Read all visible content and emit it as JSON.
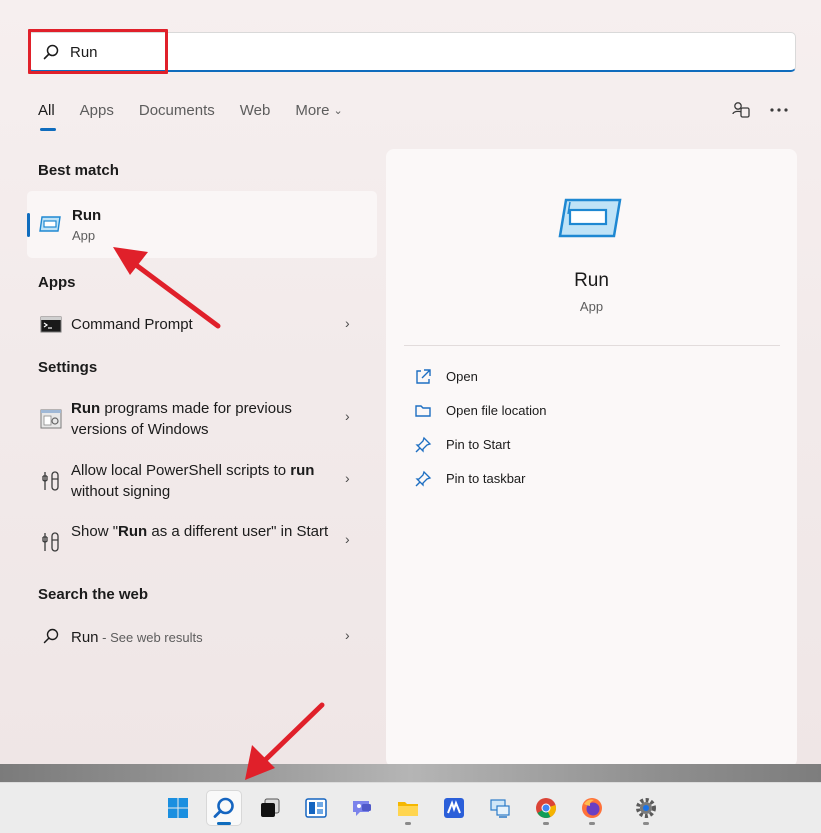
{
  "search": {
    "value": "Run"
  },
  "tabs": [
    {
      "label": "All"
    },
    {
      "label": "Apps"
    },
    {
      "label": "Documents"
    },
    {
      "label": "Web"
    },
    {
      "label": "More"
    }
  ],
  "best_match": {
    "heading": "Best match",
    "title": "Run",
    "subtitle": "App"
  },
  "apps": {
    "heading": "Apps",
    "items": [
      {
        "label": "Command Prompt"
      }
    ]
  },
  "settings": {
    "heading": "Settings",
    "items": [
      {
        "pre": "",
        "bold": "Run",
        "post": " programs made for previous versions of Windows"
      },
      {
        "pre": "Allow local PowerShell scripts to ",
        "bold": "run",
        "post": " without signing"
      },
      {
        "pre": "Show \"",
        "bold": "Run",
        "post": " as a different user\" in Start"
      }
    ]
  },
  "web": {
    "heading": "Search the web",
    "query": "Run",
    "suffix": " - See web results"
  },
  "detail": {
    "title": "Run",
    "subtitle": "App",
    "actions": [
      {
        "label": "Open",
        "icon": "open-external-icon"
      },
      {
        "label": "Open file location",
        "icon": "folder-icon"
      },
      {
        "label": "Pin to Start",
        "icon": "pin-icon"
      },
      {
        "label": "Pin to taskbar",
        "icon": "pin-icon"
      }
    ]
  },
  "taskbar": {
    "icons": [
      "windows-start-icon",
      "search-icon",
      "task-view-icon",
      "widgets-icon",
      "chat-icon",
      "file-explorer-icon",
      "app-icon",
      "network-icon",
      "chrome-icon",
      "firefox-icon",
      "settings-icon"
    ]
  },
  "colors": {
    "accent": "#0f6cbd",
    "annotation": "#e0202a"
  }
}
